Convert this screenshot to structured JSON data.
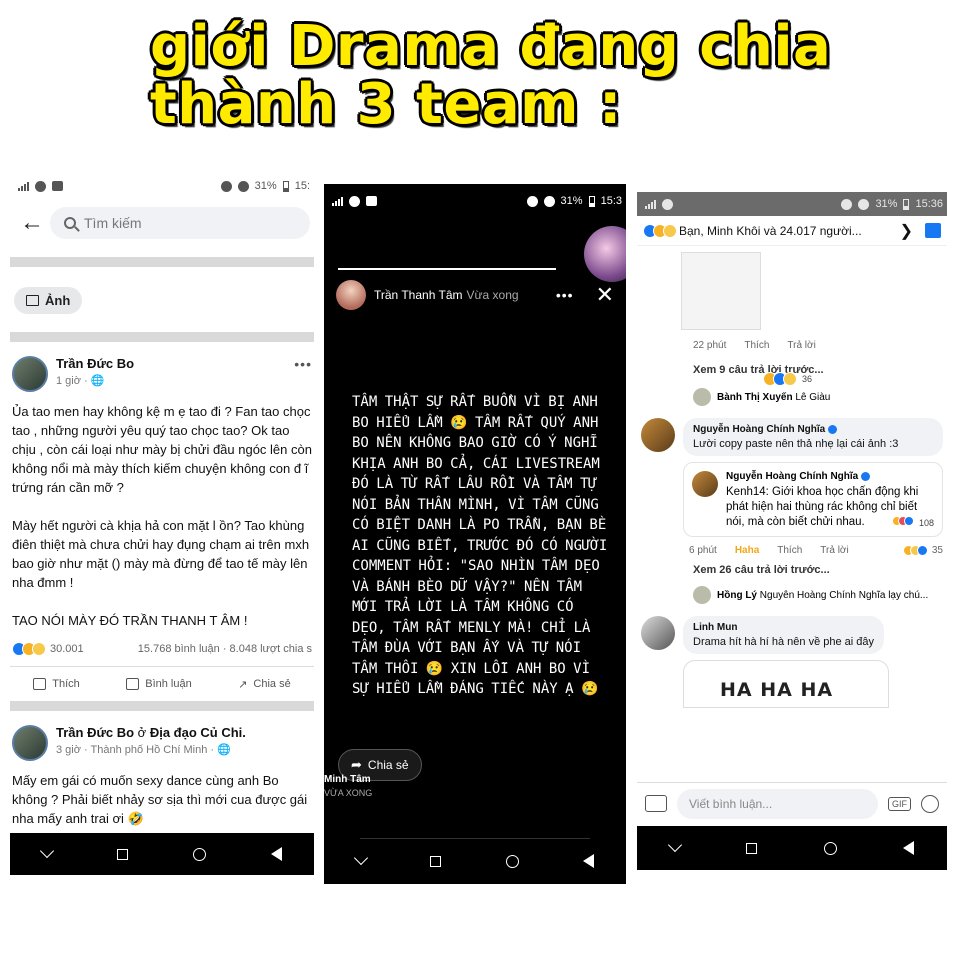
{
  "headline": {
    "line1": "giới Drama đang chia",
    "line2": "thành 3 team :"
  },
  "colors": {
    "headline_fill": "#ffeb00",
    "fb_blue": "#1877f2",
    "haha": "#f0a818"
  },
  "phone1": {
    "status": {
      "battery": "31%",
      "time": "15:"
    },
    "search_placeholder": "Tìm kiếm",
    "chip_label": "Ảnh",
    "post1": {
      "author": "Trần Đức Bo",
      "time": "1 giờ ·",
      "body": "Ủa tao men hay không kệ m ẹ tao đi ? Fan tao chọc tao , những người yêu quý tao chọc tao? Ok tao chịu , còn cái loại như mày bị chửi đầu ngóc lên còn không nổi mà mày thích kiếm chuyện không con đ ĩ trứng rán cần mỡ ?\n\nMày hết người cà khịa hả con mặt l ồn? Tao khùng điên thiệt mà chưa chửi hay đụng chạm ai trên mxh bao giờ như mặt () mày mà đừng để tao tế mày lên nha đmm !\n\nTAO NÓI MÀY ĐÓ TRẦN THANH T ÂM !",
      "reactions_count": "30.001",
      "comments_shares": "15.768 bình luận · 8.048 lượt chia s",
      "actions": [
        "Thích",
        "Bình luận",
        "Chia sẻ"
      ]
    },
    "post2": {
      "author": "Trần Đức Bo",
      "at": "ở",
      "place": "Địa đạo Củ Chi.",
      "meta": "3 giờ · Thành phố Hồ Chí Minh ·",
      "body": "Mấy em gái có muốn sexy dance cùng anh Bo không ? Phải biết nhảy sơ sịa thì mới cua được gái nha mấy anh trai ơi 🤣"
    }
  },
  "phone2": {
    "status": {
      "battery": "31%",
      "time": "15:3"
    },
    "progress": 1,
    "author": "Trần Thanh Tâm",
    "time": "Vừa xong",
    "story_text": "TÂM THẬT SỰ RẤT BUỒN VÌ BỊ ANH BO HIỂU LẦM 😢 TÂM RẤT QUÝ ANH BO NÊN KHÔNG BAO GIỜ CÓ Ý NGHĨ KHỊA ANH BO CẢ, CÁI LIVESTREAM ĐÓ LÀ TỪ RẤT LÂU RỒI VÀ TÂM TỰ NÓI BẢN THÂN MÌNH, VÌ TÂM CŨNG CÓ BIỆT DANH LÀ PO TRẦN, BẠN BÈ AI CŨNG BIẾT, TRƯỚC ĐÓ CÓ NGƯỜI COMMENT HỎI: \"SAO NHÌN TÂM DẸO VÀ BÁNH BÈO DỮ VẬY?\" NÊN TÂM MỚI TRẢ LỜI LÀ TÂM KHÔNG CÓ DẸO, TÂM RẤT MENLY MÀ! CHỈ LÀ TÂM ĐÙA VỚI BẠN ẤY VÀ TỰ NÓI TÂM THÔI 😢 XIN LỖI ANH BO VÌ SỰ HIỂU LẦM ĐÁNG TIẾC NÀY Ạ 😢",
    "share_label": "Chia sẻ",
    "footer_name": "Minh Tâm",
    "footer_time": "VỪA XONG"
  },
  "phone3": {
    "status": {
      "battery": "31%",
      "time": "15:36"
    },
    "reactions_header": "Bạn, Minh Khôi và 24.017 người...",
    "img_comment": {
      "reactions": "36",
      "time": "22 phút",
      "like": "Thích",
      "reply": "Trả lời"
    },
    "view_more_1": "Xem 9 câu trả lời trước...",
    "reply_1": {
      "name": "Bành Thị Xuyến",
      "text": "Lê Giàu"
    },
    "comment_1": {
      "name": "Nguyễn Hoàng Chính Nghĩa",
      "text": "Lười copy paste nên thả nhẹ lại cái ảnh :3"
    },
    "shared": {
      "name": "Nguyễn Hoàng Chính Nghĩa",
      "text": "Kenh14: Giới khoa học chấn động khi phát hiện hai thùng rác không chỉ biết nói, mà còn biết chửi nhau.",
      "reactions": "108"
    },
    "comment_1_meta": {
      "time": "6 phút",
      "haha": "Haha",
      "like": "Thích",
      "reply": "Trả lời",
      "reactions": "35"
    },
    "view_more_2": "Xem 26 câu trả lời trước...",
    "reply_2": {
      "name": "Hồng Lý",
      "text": "Nguyễn Hoàng Chính Nghĩa lạy chú..."
    },
    "comment_2": {
      "name": "Linh Mun",
      "text": "Drama hít hà hí hà nên về phe ai đây"
    },
    "hh_text": "HA HA  HA",
    "composer_placeholder": "Viết bình luận...",
    "gif_label": "GIF"
  }
}
